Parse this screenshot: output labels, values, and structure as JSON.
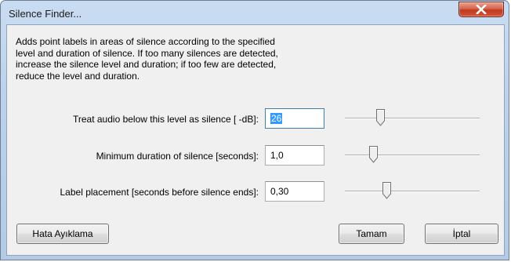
{
  "window": {
    "title": "Silence Finder...",
    "close_icon": "close-x-icon"
  },
  "description": "Adds point labels in areas of silence according to the specified\nlevel and duration of silence. If too many silences are detected,\nincrease the silence level and duration; if too few are detected,\nreduce the level and duration.",
  "fields": {
    "level": {
      "label": "Treat audio below this level as silence [ -dB]:",
      "value": "26",
      "slider_level": 0.25
    },
    "duration": {
      "label": "Minimum duration of silence [seconds]:",
      "value": "1,0",
      "slider_level": 0.19
    },
    "placement": {
      "label": "Label placement [seconds before silence ends]:",
      "value": "0,30",
      "slider_level": 0.3
    }
  },
  "buttons": {
    "debug": "Hata Ayıklama",
    "ok": "Tamam",
    "cancel": "İptal"
  }
}
